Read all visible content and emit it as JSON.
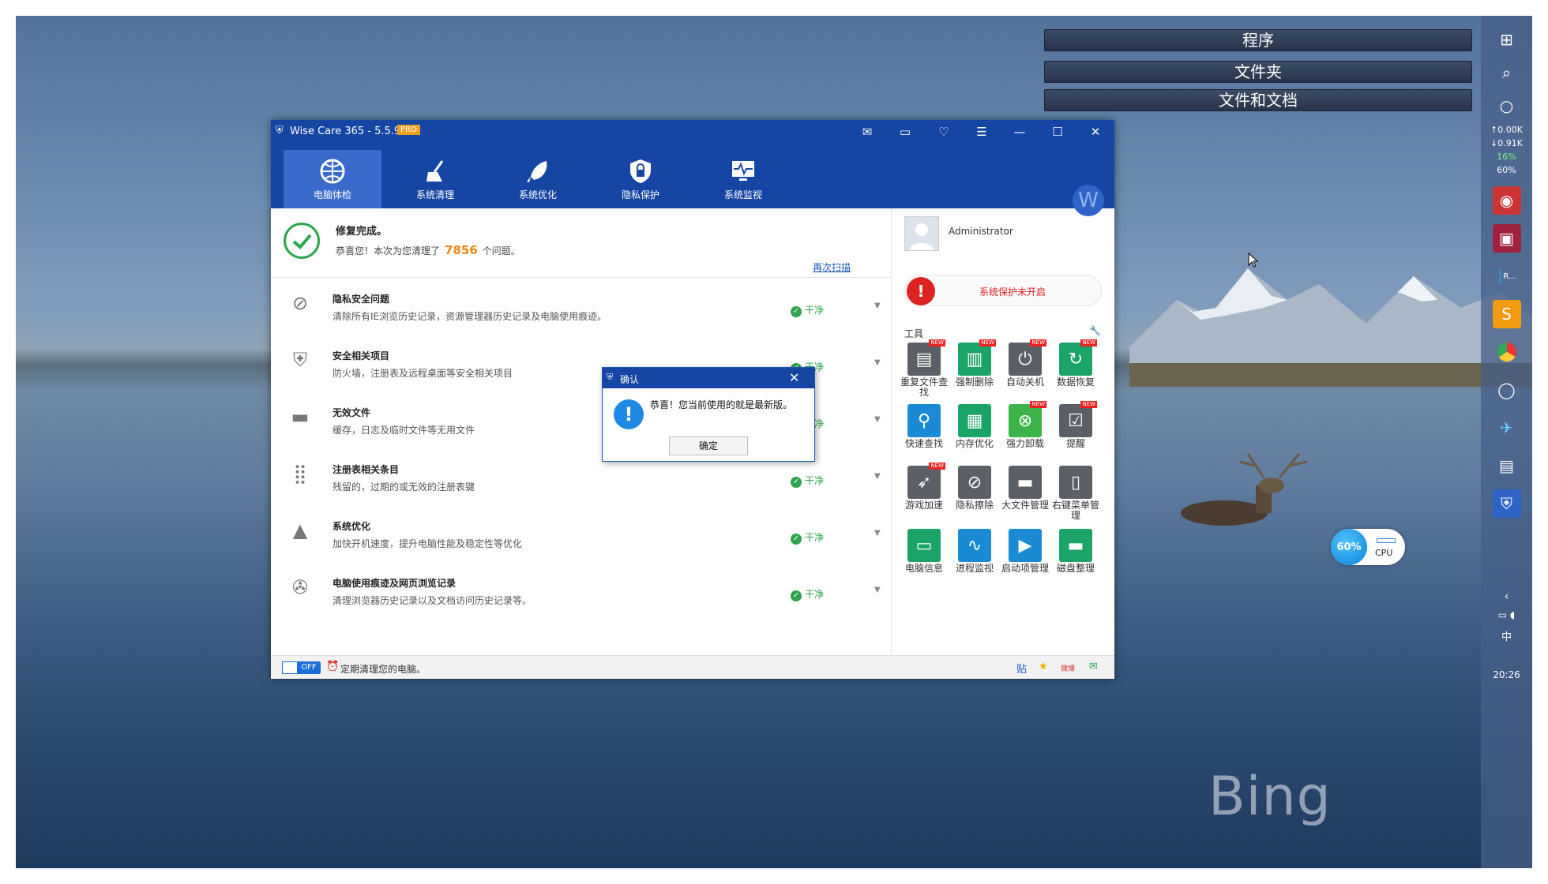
{
  "desktop": {
    "brand": "Bing",
    "search_buttons": [
      "程序",
      "文件夹",
      "文件和文档"
    ]
  },
  "taskbar": {
    "net_up": "↑0.00K",
    "net_down": "↓0.91K",
    "net_pct": "16%",
    "mem_pct": "60%",
    "app_label": "R...",
    "ime": "中",
    "clock": "20:26"
  },
  "cpu_widget": {
    "value": "60%",
    "label": "CPU"
  },
  "window": {
    "title": "Wise Care 365 - 5.5.9",
    "edition": "PRO",
    "nav": [
      {
        "label": "电脑体检"
      },
      {
        "label": "系统清理"
      },
      {
        "label": "系统优化"
      },
      {
        "label": "隐私保护"
      },
      {
        "label": "系统监视"
      }
    ],
    "avatar_letter": "W"
  },
  "status": {
    "title": "修复完成。",
    "prefix": "恭喜您！本次为您清理了",
    "count": "7856",
    "suffix": "个问题。",
    "rescan": "再次扫描"
  },
  "items": [
    {
      "title": "隐私安全问题",
      "desc": "清除所有IE浏览历史记录，资源管理器历史记录及电脑使用痕迹。",
      "status": "干净"
    },
    {
      "title": "安全相关项目",
      "desc": "防火墙，注册表及远程桌面等安全相关项目",
      "status": "干净"
    },
    {
      "title": "无效文件",
      "desc": "缓存，日志及临时文件等无用文件",
      "status": "干净"
    },
    {
      "title": "注册表相关条目",
      "desc": "残留的，过期的或无效的注册表键",
      "status": "干净"
    },
    {
      "title": "系统优化",
      "desc": "加快开机速度，提升电脑性能及稳定性等优化",
      "status": "干净"
    },
    {
      "title": "电脑使用痕迹及网页浏览记录",
      "desc": "清理浏览器历史记录以及文档访问历史记录等。",
      "status": "干净"
    }
  ],
  "user": {
    "name": "Administrator"
  },
  "protection": {
    "text": "系统保护未开启"
  },
  "tools": {
    "title": "工具",
    "new_badge": "NEW",
    "items": [
      {
        "label": "重复文件查找",
        "color": "gray"
      },
      {
        "label": "强制删除",
        "color": "green"
      },
      {
        "label": "自动关机",
        "color": "gray"
      },
      {
        "label": "数据恢复",
        "color": "green"
      },
      {
        "label": "快速查找",
        "color": "blue"
      },
      {
        "label": "内存优化",
        "color": "green"
      },
      {
        "label": "强力卸载",
        "color": "lime"
      },
      {
        "label": "提醒",
        "color": "gray"
      },
      {
        "label": "游戏加速",
        "color": "gray"
      },
      {
        "label": "隐私擦除",
        "color": "gray"
      },
      {
        "label": "大文件管理",
        "color": "gray"
      },
      {
        "label": "右键菜单管理",
        "color": "gray"
      },
      {
        "label": "电脑信息",
        "color": "green"
      },
      {
        "label": "进程监视",
        "color": "blue"
      },
      {
        "label": "启动项管理",
        "color": "blue"
      },
      {
        "label": "磁盘整理",
        "color": "green"
      }
    ]
  },
  "footer": {
    "toggle": "OFF",
    "text": "定期清理您的电脑。",
    "icons": [
      "贴",
      "★",
      "微博",
      "✉"
    ]
  },
  "dialog": {
    "title": "确认",
    "message": "恭喜！您当前使用的就是最新版。",
    "ok": "确定"
  }
}
